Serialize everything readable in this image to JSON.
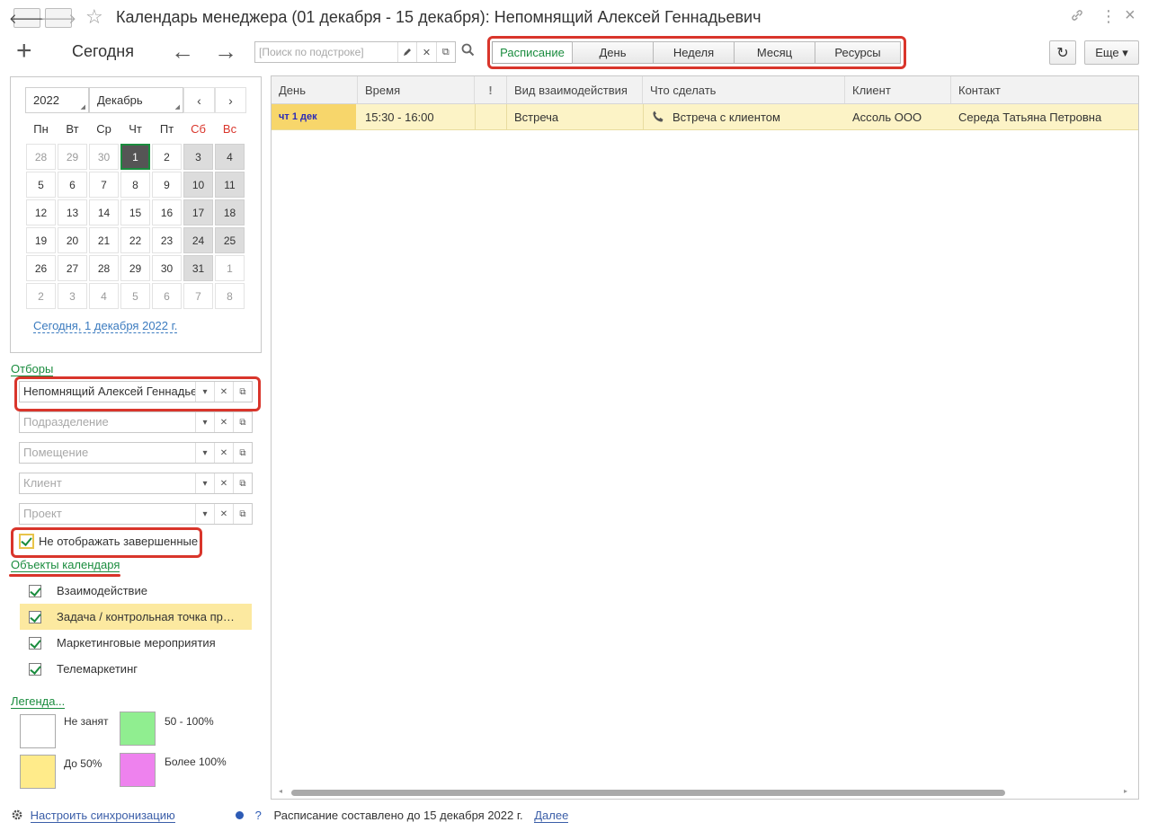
{
  "window": {
    "title": "Календарь менеджера (01 декабря - 15 декабря): Непомнящий Алексей Геннадьевич",
    "back_label": "🡐",
    "forward_label": "🡒",
    "star_glyph": "☆",
    "link_glyph": "🔗",
    "menu_glyph": "⋮",
    "close_glyph": "×"
  },
  "toolbar": {
    "add_label": "+",
    "today_label": "Сегодня",
    "prev_label": "←",
    "next_label": "→",
    "search_placeholder": "[Поиск по подстроке]",
    "search_value": "",
    "view_tabs": [
      "Расписание",
      "День",
      "Неделя",
      "Месяц",
      "Ресурсы"
    ],
    "active_view": "Расписание",
    "refresh_glyph": "↻",
    "more_label": "Еще ▾"
  },
  "calendar": {
    "year": "2022",
    "month": "Декабрь",
    "prev": "‹",
    "next": "›",
    "weekdays": [
      "Пн",
      "Вт",
      "Ср",
      "Чт",
      "Пт",
      "Сб",
      "Вс"
    ],
    "weeks": [
      [
        "28",
        "29",
        "30",
        "1",
        "2",
        "3",
        "4"
      ],
      [
        "5",
        "6",
        "7",
        "8",
        "9",
        "10",
        "11"
      ],
      [
        "12",
        "13",
        "14",
        "15",
        "16",
        "17",
        "18"
      ],
      [
        "19",
        "20",
        "21",
        "22",
        "23",
        "24",
        "25"
      ],
      [
        "26",
        "27",
        "28",
        "29",
        "30",
        "31",
        "1"
      ],
      [
        "2",
        "3",
        "4",
        "5",
        "6",
        "7",
        "8"
      ]
    ],
    "selected_day": "1",
    "today_link": "Сегодня, 1 декабря 2022 г."
  },
  "filters": {
    "title": "Отборы",
    "fields": [
      {
        "value": "Непомнящий Алексей Геннадьевич",
        "placeholder": ""
      },
      {
        "value": "",
        "placeholder": "Подразделение"
      },
      {
        "value": "",
        "placeholder": "Помещение"
      },
      {
        "value": "",
        "placeholder": "Клиент"
      },
      {
        "value": "",
        "placeholder": "Проект"
      }
    ],
    "hide_completed_label": "Не отображать завершенные",
    "hide_completed_checked": true
  },
  "calendar_objects": {
    "title": "Объекты календаря",
    "items": [
      {
        "label": "Взаимодействие",
        "checked": true
      },
      {
        "label": "Задача / контрольная точка проекта",
        "checked": true
      },
      {
        "label": "Маркетинговые мероприятия",
        "checked": true
      },
      {
        "label": "Телемаркетинг",
        "checked": true
      }
    ]
  },
  "legend": {
    "title": "Легенда...",
    "items": [
      {
        "label": "Не занят",
        "color": "#ffffff"
      },
      {
        "label": "50 - 100%",
        "color": "#90ee90"
      },
      {
        "label": "До 50%",
        "color": "#ffeb8a"
      },
      {
        "label": "Более 100%",
        "color": "#ee82ee"
      }
    ]
  },
  "table": {
    "columns": [
      "День",
      "Время",
      "!",
      "Вид взаимодействия",
      "Что сделать",
      "Клиент",
      "Контакт"
    ],
    "rows": [
      {
        "day": "чт 1 дек",
        "time": "15:30 - 16:00",
        "priority": "",
        "type": "Встреча",
        "todo": "Встреча с клиентом",
        "todo_icon": "phone-icon",
        "client": "Ассоль ООО",
        "contact": "Середа Татьяна Петровна"
      }
    ]
  },
  "footer": {
    "sync_link": "Настроить синхронизацию",
    "help_glyph": "?",
    "status_text": "Расписание составлено до 15 декабря 2022 г.",
    "next_link": "Далее"
  },
  "colors": {
    "accent_green": "#1a8c3e",
    "highlight_red": "#d9352b",
    "row_yellow": "#fcf3c6",
    "weekend_gray": "#dcdcdc"
  }
}
